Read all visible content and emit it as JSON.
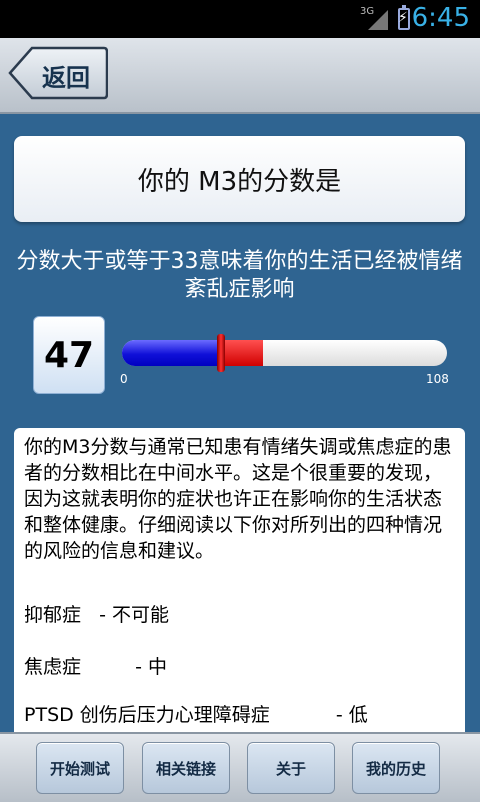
{
  "status_bar": {
    "network": "3G",
    "time": "6:45"
  },
  "header": {
    "back_label": "返回"
  },
  "title": "你的 M3的分数是",
  "subtitle": "分数大于或等于33意味着你的生活已经被情绪紊乱症影响",
  "score": {
    "value": "47",
    "min_label": "0",
    "max_label": "108",
    "fill_fraction": 0.435,
    "threshold_fraction": 0.306,
    "colors": {
      "low": "#0000cc",
      "high": "#dd0000"
    }
  },
  "info": {
    "paragraph": "你的M3分数与通常已知患有情绪失调或焦虑症的患者的分数相比在中间水平。这是个很重要的发现， 因为这就表明你的症状也许正在影响你的生活状态和整体健康。仔细阅读以下你对所列出的四种情况的风险的信息和建议。",
    "risks": [
      {
        "label": "抑郁症",
        "level": "- 不可能"
      },
      {
        "label": "焦虑症",
        "level": "- 中"
      },
      {
        "label": "PTSD 创伤后压力心理障碍症",
        "level": "- 低"
      }
    ]
  },
  "bottom_nav": {
    "buttons": [
      "开始测试",
      "相关链接",
      "关于",
      "我的历史"
    ]
  }
}
